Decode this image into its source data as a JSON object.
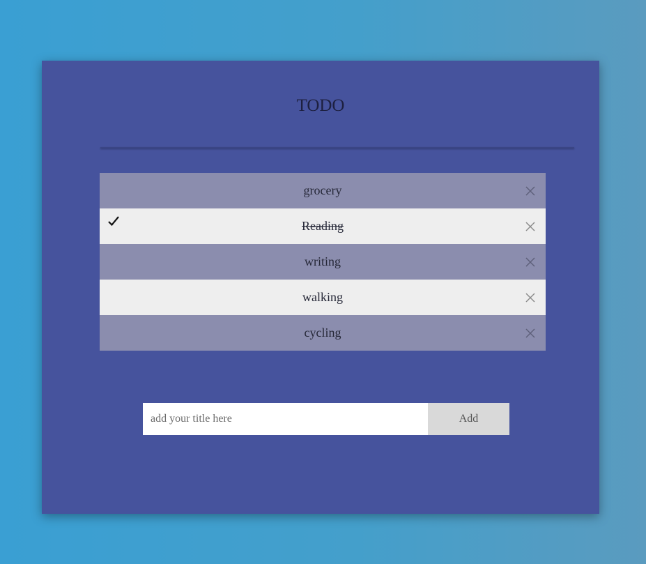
{
  "app": {
    "title": "TODO"
  },
  "todos": [
    {
      "label": "grocery",
      "checked": false
    },
    {
      "label": "Reading",
      "checked": true
    },
    {
      "label": "writing",
      "checked": false
    },
    {
      "label": "walking",
      "checked": false
    },
    {
      "label": "cycling",
      "checked": false
    }
  ],
  "form": {
    "placeholder": "add your title here",
    "add_label": "Add"
  },
  "icons": {
    "check": "check-icon",
    "close": "close-icon"
  },
  "colors": {
    "card": "#46539d",
    "row_odd": "#8b8dae",
    "row_even": "#eeeeee",
    "button": "#d9d9d9"
  }
}
